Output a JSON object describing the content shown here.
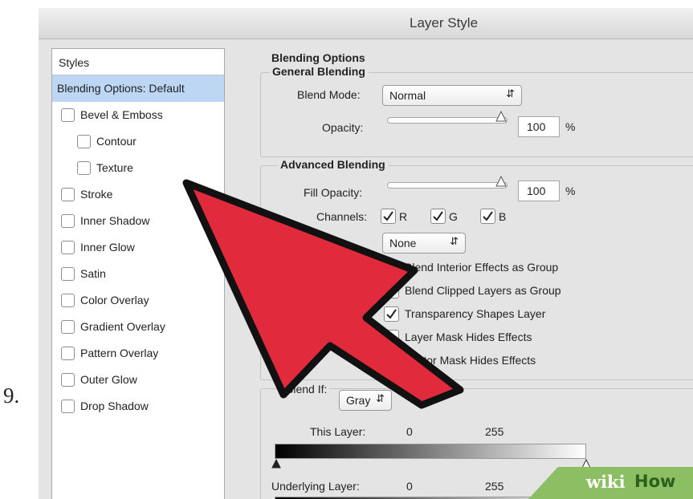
{
  "step_number": "9.",
  "window": {
    "title": "Layer Style"
  },
  "styles": {
    "header": "Styles",
    "items": [
      {
        "label": "Blending Options: Default",
        "selected": true,
        "has_checkbox": false,
        "indent": false
      },
      {
        "label": "Bevel & Emboss",
        "checked": false,
        "has_checkbox": true,
        "indent": false
      },
      {
        "label": "Contour",
        "checked": false,
        "has_checkbox": true,
        "indent": true
      },
      {
        "label": "Texture",
        "checked": false,
        "has_checkbox": true,
        "indent": true
      },
      {
        "label": "Stroke",
        "checked": false,
        "has_checkbox": true,
        "indent": false
      },
      {
        "label": "Inner Shadow",
        "checked": false,
        "has_checkbox": true,
        "indent": false
      },
      {
        "label": "Inner Glow",
        "checked": false,
        "has_checkbox": true,
        "indent": false
      },
      {
        "label": "Satin",
        "checked": false,
        "has_checkbox": true,
        "indent": false
      },
      {
        "label": "Color Overlay",
        "checked": false,
        "has_checkbox": true,
        "indent": false
      },
      {
        "label": "Gradient Overlay",
        "checked": false,
        "has_checkbox": true,
        "indent": false
      },
      {
        "label": "Pattern Overlay",
        "checked": false,
        "has_checkbox": true,
        "indent": false
      },
      {
        "label": "Outer Glow",
        "checked": false,
        "has_checkbox": true,
        "indent": false
      },
      {
        "label": "Drop Shadow",
        "checked": false,
        "has_checkbox": true,
        "indent": false
      }
    ]
  },
  "blending_options": {
    "title": "Blending Options",
    "general": {
      "title": "General Blending",
      "blend_mode_label": "Blend Mode:",
      "blend_mode_value": "Normal",
      "opacity_label": "Opacity:",
      "opacity_value": "100",
      "opacity_unit": "%",
      "opacity_level": 1.0
    },
    "advanced": {
      "title": "Advanced Blending",
      "fill_opacity_label": "Fill Opacity:",
      "fill_opacity_value": "100",
      "fill_opacity_unit": "%",
      "fill_opacity_level": 1.0,
      "channels_label": "Channels:",
      "channels": [
        {
          "label": "R",
          "checked": true
        },
        {
          "label": "G",
          "checked": true
        },
        {
          "label": "B",
          "checked": true
        }
      ],
      "knockout_value": "None",
      "options": [
        {
          "label": "Blend Interior Effects as Group",
          "checked": false
        },
        {
          "label": "Blend Clipped Layers as Group",
          "checked": true
        },
        {
          "label": "Transparency Shapes Layer",
          "checked": true
        },
        {
          "label": "Layer Mask Hides Effects",
          "checked": false
        },
        {
          "label": "Vector Mask Hides Effects",
          "checked": false
        }
      ]
    },
    "blend_if": {
      "label": "Blend If:",
      "value": "Gray",
      "this_layer_label": "This Layer:",
      "this_layer_min": "0",
      "this_layer_max": "255",
      "underlying_label": "Underlying Layer:",
      "underlying_min": "0",
      "underlying_max": "255"
    }
  },
  "overlay_arrow": {
    "color": "#e22a3d",
    "outline": "#111111",
    "icon": "red-pointer-arrow-icon"
  },
  "watermark": {
    "part1": "wiki",
    "part2": "How",
    "bg": "#8cbf63"
  }
}
